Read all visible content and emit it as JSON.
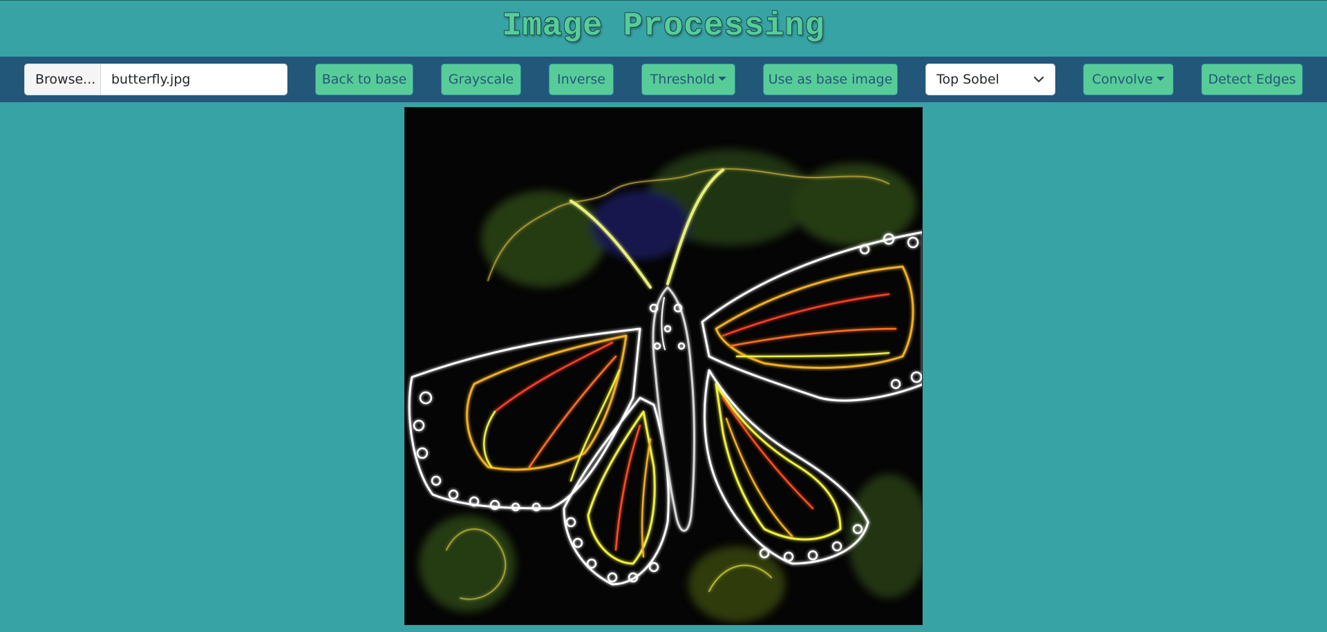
{
  "app": {
    "title": "Image Processing"
  },
  "file_picker": {
    "browse_label": "Browse...",
    "file_name": "butterfly.jpg"
  },
  "toolbar": {
    "back_to_base": "Back to base",
    "grayscale": "Grayscale",
    "inverse": "Inverse",
    "threshold": "Threshold",
    "use_as_base": "Use as base image",
    "kernel_select": "Top Sobel",
    "convolve": "Convolve",
    "detect_edges": "Detect Edges"
  },
  "icons": {
    "caret": "caret-down-icon",
    "chevron": "chevron-down-icon"
  },
  "colors": {
    "background": "#38a3a5",
    "toolbar": "#22577a",
    "button": "#57cc99",
    "button_text": "#22577a",
    "title": "#57cc99"
  }
}
